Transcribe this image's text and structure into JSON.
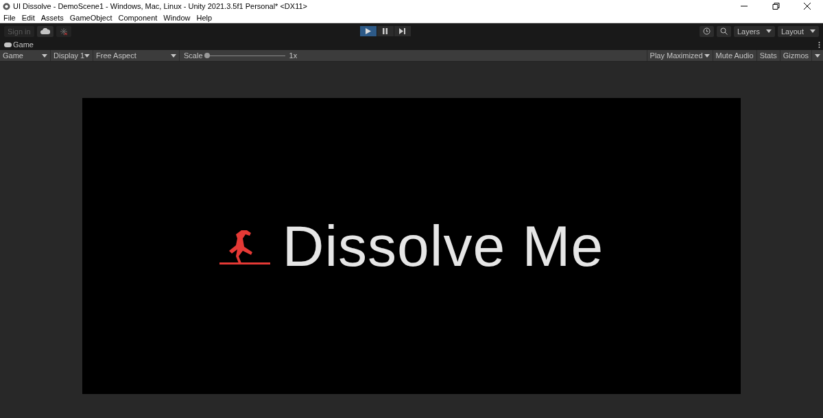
{
  "window": {
    "title": "UI Dissolve - DemoScene1 - Windows, Mac, Linux - Unity 2021.3.5f1 Personal* <DX11>"
  },
  "menu": [
    "File",
    "Edit",
    "Assets",
    "GameObject",
    "Component",
    "Window",
    "Help"
  ],
  "toolbar": {
    "sign_in": {
      "label": "Sign in",
      "disabled": true
    },
    "play_controls": [
      {
        "kind": "play",
        "selected": true
      },
      {
        "kind": "pause",
        "selected": false
      },
      {
        "kind": "step",
        "selected": false
      }
    ],
    "layers": "Layers",
    "layout": "Layout"
  },
  "tab": {
    "label": "Game"
  },
  "game_toolbar": {
    "left": [
      {
        "label": "Game"
      },
      {
        "label": "Display 1"
      },
      {
        "label": "Free Aspect"
      }
    ],
    "scale": {
      "label": "Scale",
      "level": 0.0,
      "reading": "1x"
    },
    "right": [
      {
        "label": "Play Maximized",
        "kind": "dropdown"
      },
      {
        "label": "Mute Audio",
        "kind": "toggle"
      },
      {
        "label": "Stats",
        "kind": "toggle"
      },
      {
        "label": "Gizmos",
        "kind": "split"
      }
    ]
  },
  "game_view": {
    "text": "Dissolve Me"
  }
}
